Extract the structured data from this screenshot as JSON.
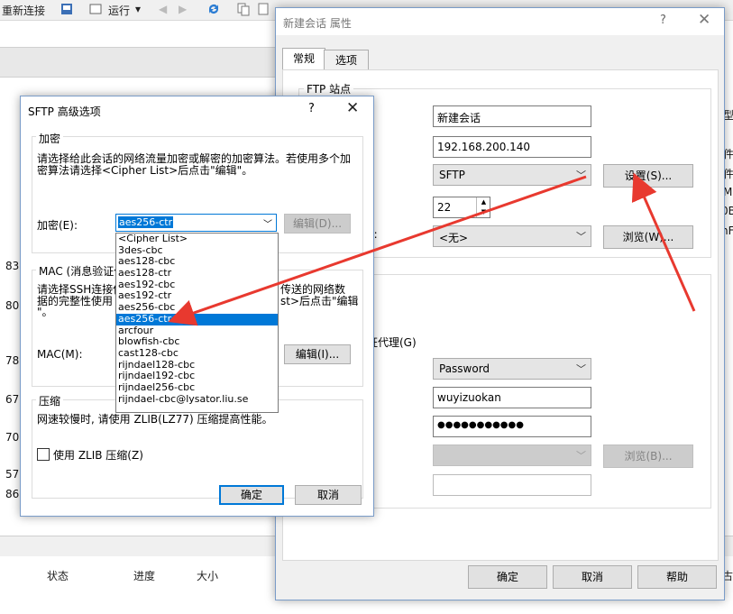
{
  "background_app": {
    "toolbar": {
      "new_connection": "重新连接",
      "run": "运行",
      "run_arrow": "▾"
    },
    "left_numbers": [
      "83",
      "80",
      "78",
      "67",
      "70",
      "57",
      "86"
    ],
    "right_fragments": [
      "型",
      "件",
      "件",
      "M",
      "0B",
      "nF"
    ],
    "row_text_a": "—",
    "status_bar": {
      "status": "状态",
      "progress": "进度",
      "size": "大小",
      "right": "古"
    }
  },
  "properties_dialog": {
    "title": "新建会话 属性",
    "help_glyph": "?",
    "close_glyph": "✕",
    "tabs": [
      "常规",
      "选项"
    ],
    "ftp_group_title": "FTP 站点",
    "name_value": "新建会话",
    "host_value": "192.168.200.140",
    "protocol_value": "SFTP",
    "settings_button": "设置(S)...",
    "port_value": "22",
    "colon_label": "):",
    "proxy_value": "<无>",
    "browse_button_1": "浏览(W)...",
    "partial_label_1": ")",
    "partial_label_2": "证代理(G)",
    "auth_method_value": "Password",
    "username_value": "wuyizuokan",
    "password_value": "●●●●●●●●●●●",
    "browse_button_2": "浏览(B)...",
    "ok_button": "确定",
    "cancel_button": "取消",
    "help_button": "帮助"
  },
  "sftp_dialog": {
    "title": "SFTP 高级选项",
    "help_glyph": "?",
    "close_glyph": "✕",
    "encryption_group": "加密",
    "encryption_desc_1": "请选择给此会话的网络流量加密或解密的加密算法。若使用多个加",
    "encryption_desc_2": "密算法请选择<Cipher List>后点击\"编辑\"。",
    "encryption_label": "加密(E):",
    "encryption_value": "aes256-ctr",
    "edit_d_button": "编辑(D)...",
    "mac_group": "MAC (消息验证代",
    "mac_desc_1": "请选择SSH连接使",
    "mac_desc_1_right": "传送的网络数",
    "mac_desc_2": "据的完整性使用",
    "mac_desc_2_right": "st>后点击\"编辑",
    "mac_desc_3": "\"。",
    "mac_label": "MAC(M):",
    "edit_i_button": "编辑(I)...",
    "compress_group": "压缩",
    "compress_desc": "网速较慢时, 请使用 ZLIB(LZ77) 压缩提高性能。",
    "zlib_checkbox_label": "使用 ZLIB 压缩(Z)",
    "ok_button": "确定",
    "cancel_button": "取消",
    "cipher_options": [
      "<Cipher List>",
      "3des-cbc",
      "aes128-cbc",
      "aes128-ctr",
      "aes192-cbc",
      "aes192-ctr",
      "aes256-cbc",
      "aes256-ctr",
      "arcfour",
      "blowfish-cbc",
      "cast128-cbc",
      "rijndael128-cbc",
      "rijndael192-cbc",
      "rijndael256-cbc",
      "rijndael-cbc@lysator.liu.se"
    ],
    "selected_index": 7
  },
  "colors": {
    "accent": "#0078d7",
    "arrow": "#e8392f",
    "dialog_bg": "#f0f0f0"
  }
}
